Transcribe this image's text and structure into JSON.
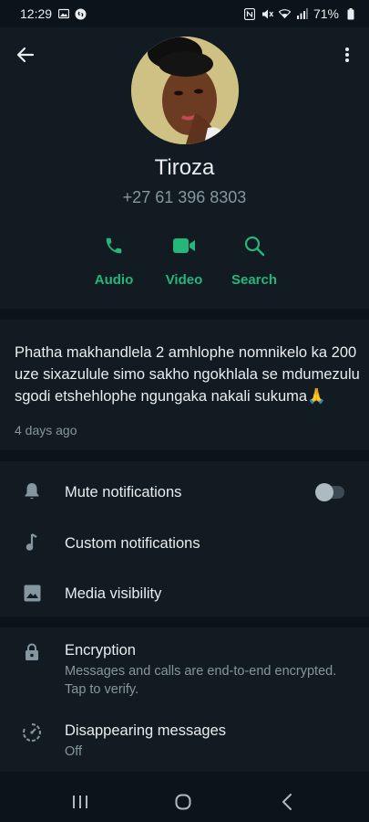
{
  "status_bar": {
    "time": "12:29",
    "battery": "71%",
    "left_icons": [
      "image-icon",
      "shazam-icon"
    ],
    "right_icons": [
      "nfc-icon",
      "mute-icon",
      "wifi-icon",
      "signal-icon",
      "battery-icon"
    ]
  },
  "contact": {
    "name": "Tiroza",
    "phone": "+27 61 396 8303"
  },
  "actions": [
    {
      "label": "Audio",
      "icon": "phone-icon"
    },
    {
      "label": "Video",
      "icon": "video-icon"
    },
    {
      "label": "Search",
      "icon": "search-icon"
    }
  ],
  "about": {
    "text": "Phatha makhandlela 2 amhlophe nomnikelo ka 200 uze sixazulule simo sakho ngokhlala se mdumezulu sgodi etshehlophe ngungaka nakali sukuma🙏",
    "date": "4 days ago"
  },
  "settings": [
    {
      "label": "Mute notifications",
      "icon": "bell-icon",
      "toggle": false
    },
    {
      "label": "Custom notifications",
      "icon": "music-note-icon"
    },
    {
      "label": "Media visibility",
      "icon": "image-icon"
    }
  ],
  "security": {
    "encryption": {
      "label": "Encryption",
      "sub": "Messages and calls are end-to-end encrypted. Tap to verify."
    },
    "disappearing": {
      "label": "Disappearing messages",
      "sub": "Off"
    }
  },
  "colors": {
    "accent": "#25b67a",
    "background": "#0b141a",
    "panel": "#111b21",
    "muted_text": "#8696a0"
  }
}
